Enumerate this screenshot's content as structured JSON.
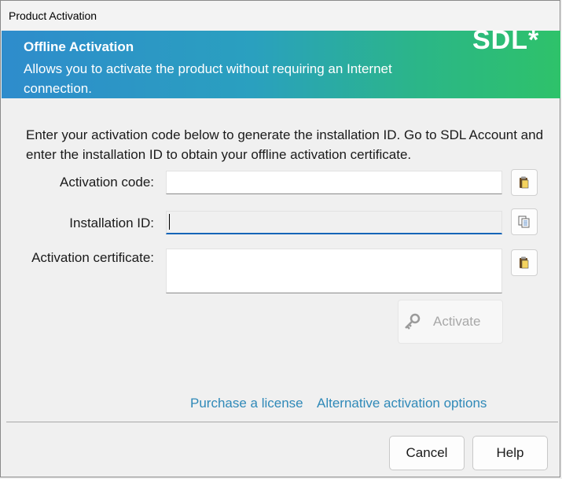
{
  "window": {
    "title": "Product Activation"
  },
  "banner": {
    "title": "Offline Activation",
    "description": "Allows you to activate the product without requiring an Internet connection.",
    "logo_text": "SDL*",
    "gradient_colors": [
      "#2e8ccc",
      "#2bb687",
      "#2ec26a"
    ]
  },
  "instructions": "Enter your activation code below to generate the installation ID. Go to SDL Account and enter the installation ID to obtain your offline activation certificate.",
  "form": {
    "activation_code": {
      "label": "Activation code:",
      "value": "",
      "button_icon": "paste-icon"
    },
    "installation_id": {
      "label": "Installation ID:",
      "value": "",
      "button_icon": "copy-icon"
    },
    "activation_certificate": {
      "label": "Activation certificate:",
      "value": "",
      "button_icon": "paste-icon"
    }
  },
  "activate_button": {
    "label": "Activate",
    "icon": "key-icon",
    "enabled": false
  },
  "links": {
    "purchase": "Purchase a license",
    "alternative": "Alternative activation options"
  },
  "footer": {
    "cancel": "Cancel",
    "help": "Help"
  },
  "colors": {
    "link": "#2f89b8",
    "focus_underline": "#1565b8"
  }
}
